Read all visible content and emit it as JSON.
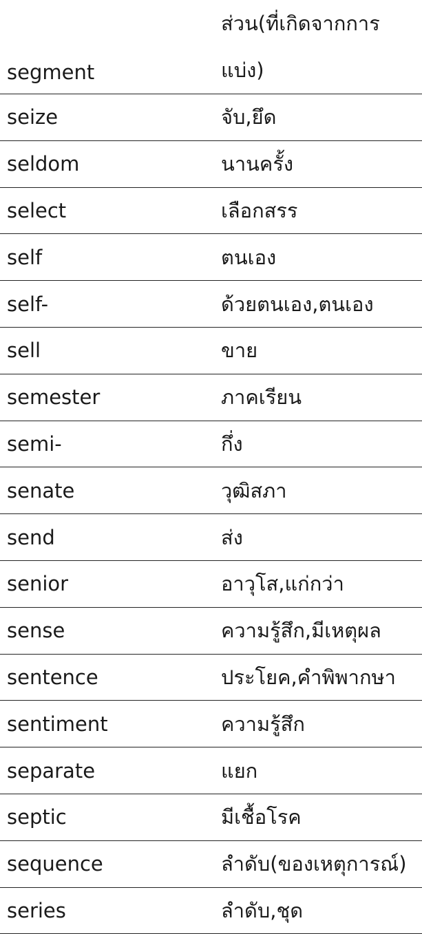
{
  "vocabulary": {
    "rows": [
      {
        "word": "segment",
        "meaning": "ส่วน(ที่เกิดจากการแบ่ง)"
      },
      {
        "word": "seize",
        "meaning": "จับ,ยึด"
      },
      {
        "word": "seldom",
        "meaning": "นานครั้ง"
      },
      {
        "word": "select",
        "meaning": "เลือกสรร"
      },
      {
        "word": "self",
        "meaning": "ตนเอง"
      },
      {
        "word": "self-",
        "meaning": "ด้วยตนเอง,ตนเอง"
      },
      {
        "word": "sell",
        "meaning": "ขาย"
      },
      {
        "word": "semester",
        "meaning": "ภาคเรียน"
      },
      {
        "word": "semi-",
        "meaning": "กึ่ง"
      },
      {
        "word": "senate",
        "meaning": "วุฒิสภา"
      },
      {
        "word": "send",
        "meaning": "ส่ง"
      },
      {
        "word": "senior",
        "meaning": "อาวุโส,แก่กว่า"
      },
      {
        "word": "sense",
        "meaning": "ความรู้สึก,มีเหตุผล"
      },
      {
        "word": "sentence",
        "meaning": "ประโยค,คำพิพากษา"
      },
      {
        "word": "sentiment",
        "meaning": "ความรู้สึก"
      },
      {
        "word": "separate",
        "meaning": "แยก"
      },
      {
        "word": "septic",
        "meaning": "มีเชื้อโรค"
      },
      {
        "word": "sequence",
        "meaning": "ลำดับ(ของเหตุการณ์)"
      },
      {
        "word": "series",
        "meaning": "ลำดับ,ชุด"
      }
    ]
  }
}
